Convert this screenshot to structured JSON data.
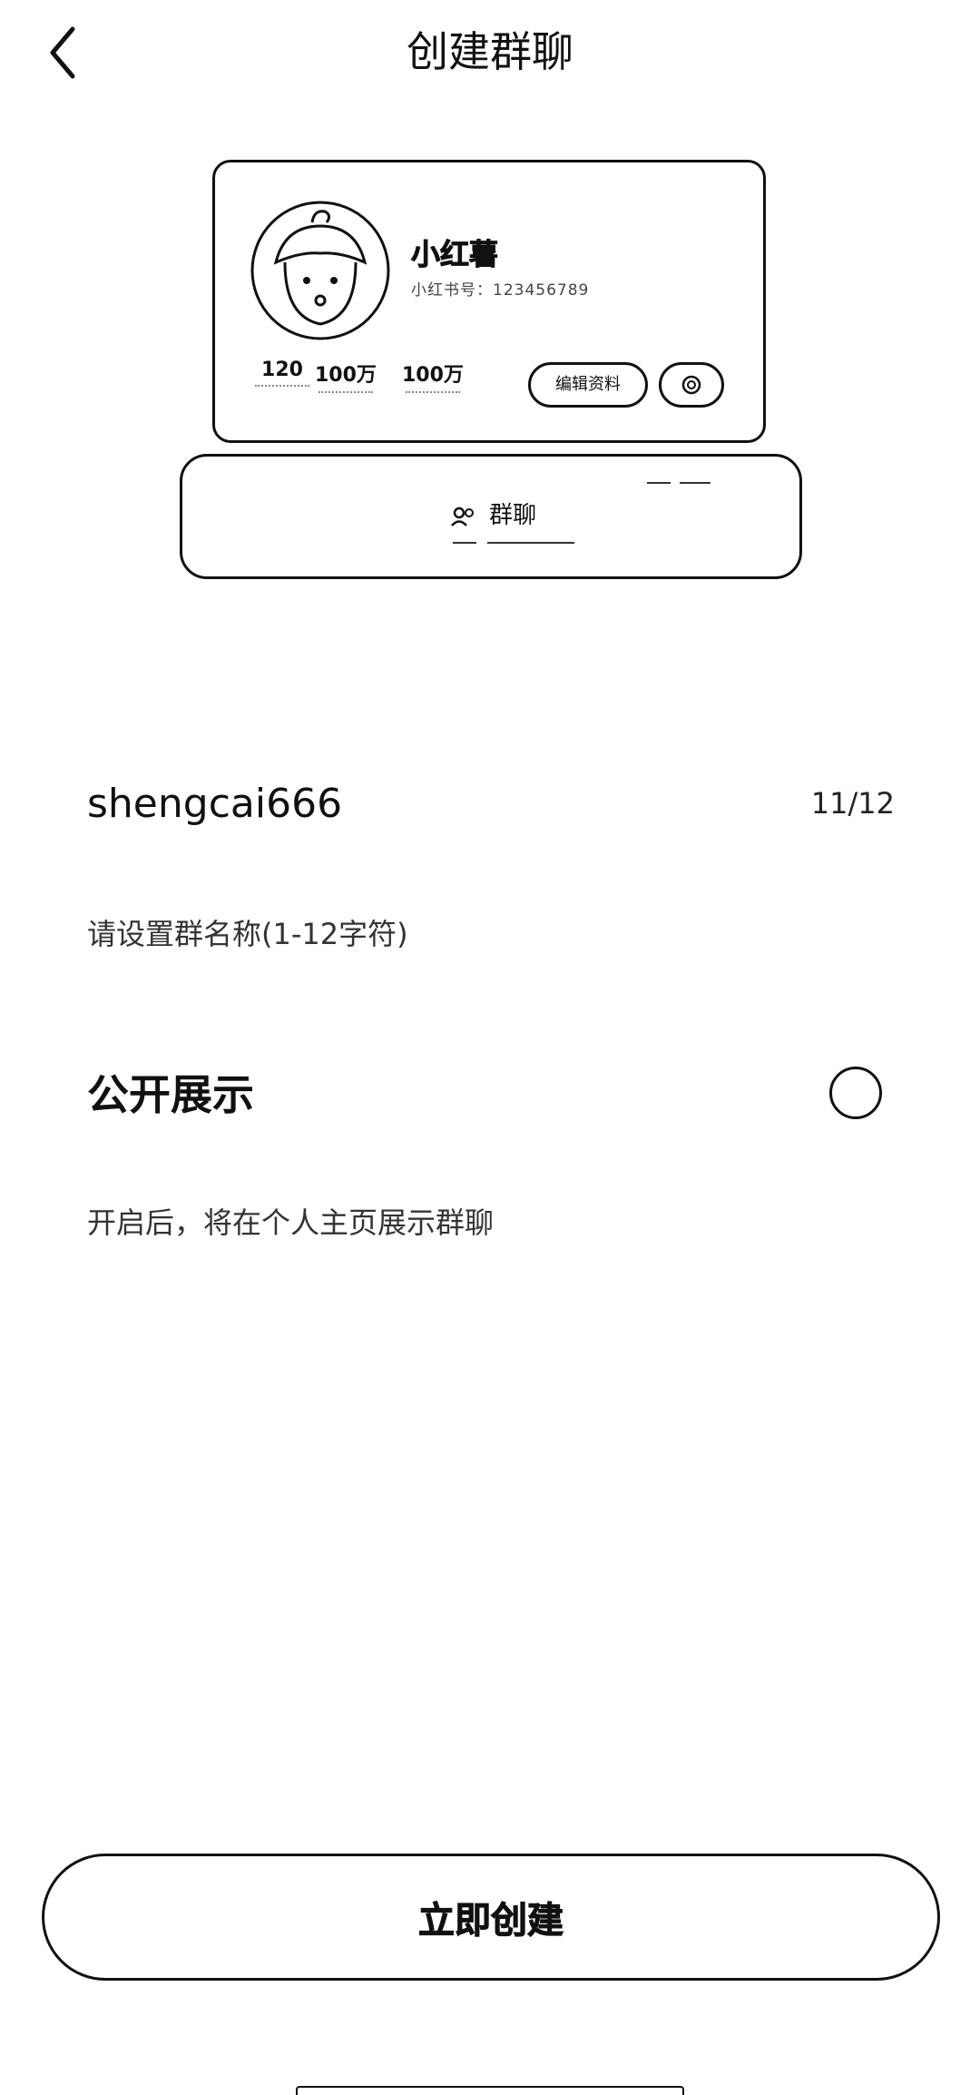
{
  "header": {
    "title": "创建群聊",
    "back_icon": "chevron-left-icon"
  },
  "illustration": {
    "name": "小红薯",
    "id_text": "小红书号：123456789",
    "stats": [
      "120",
      "100万",
      "100万"
    ],
    "edit_label": "编辑资料",
    "settings_icon": "gear-icon",
    "tab_icon": "group-icon",
    "tab_label": "群聊"
  },
  "group_name": {
    "value": "shengcai666",
    "counter": "11/12",
    "hint": "请设置群名称(1-12字符)"
  },
  "public_display": {
    "label": "公开展示",
    "checked": false,
    "description": "开启后，将在个人主页展示群聊"
  },
  "create_button": {
    "label": "立即创建"
  }
}
